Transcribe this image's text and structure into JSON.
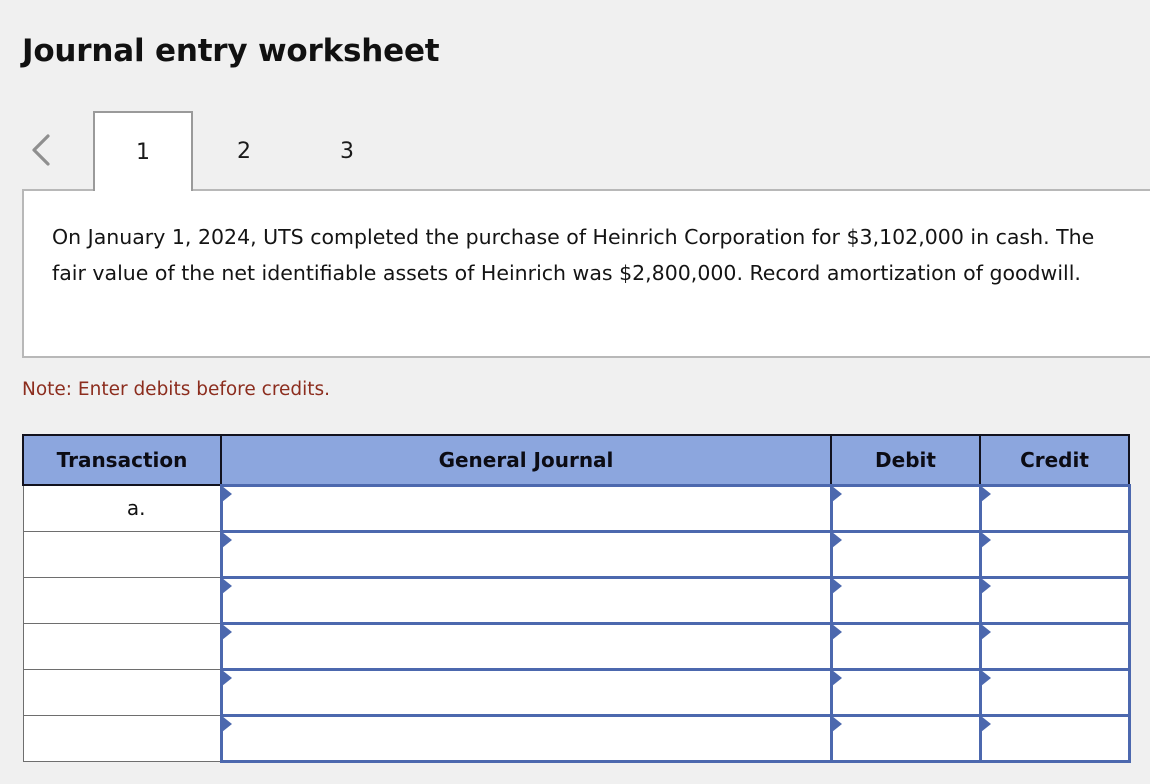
{
  "page": {
    "title": "Journal entry worksheet",
    "background_color": "#f0f0f0"
  },
  "tabs": {
    "prev_icon": "chevron-left-icon",
    "items": [
      {
        "label": "1",
        "active": true
      },
      {
        "label": "2",
        "active": false
      },
      {
        "label": "3",
        "active": false
      }
    ]
  },
  "prompt": {
    "text": "On January 1, 2024, UTS completed the purchase of Heinrich Corporation for $3,102,000 in cash. The fair value of the net identifiable assets of Heinrich was $2,800,000. Record amortization of goodwill."
  },
  "note": {
    "text": "Note: Enter debits before credits.",
    "color": "#8c2d1e"
  },
  "journal": {
    "header_color": "#8ca6de",
    "field_border_color": "#4c68ae",
    "columns": [
      {
        "key": "transaction",
        "label": "Transaction"
      },
      {
        "key": "general_journal",
        "label": "General Journal"
      },
      {
        "key": "debit",
        "label": "Debit"
      },
      {
        "key": "credit",
        "label": "Credit"
      }
    ],
    "rows": [
      {
        "transaction": "a.",
        "general_journal": "",
        "debit": "",
        "credit": ""
      },
      {
        "transaction": "",
        "general_journal": "",
        "debit": "",
        "credit": ""
      },
      {
        "transaction": "",
        "general_journal": "",
        "debit": "",
        "credit": ""
      },
      {
        "transaction": "",
        "general_journal": "",
        "debit": "",
        "credit": ""
      },
      {
        "transaction": "",
        "general_journal": "",
        "debit": "",
        "credit": ""
      },
      {
        "transaction": "",
        "general_journal": "",
        "debit": "",
        "credit": ""
      }
    ]
  }
}
